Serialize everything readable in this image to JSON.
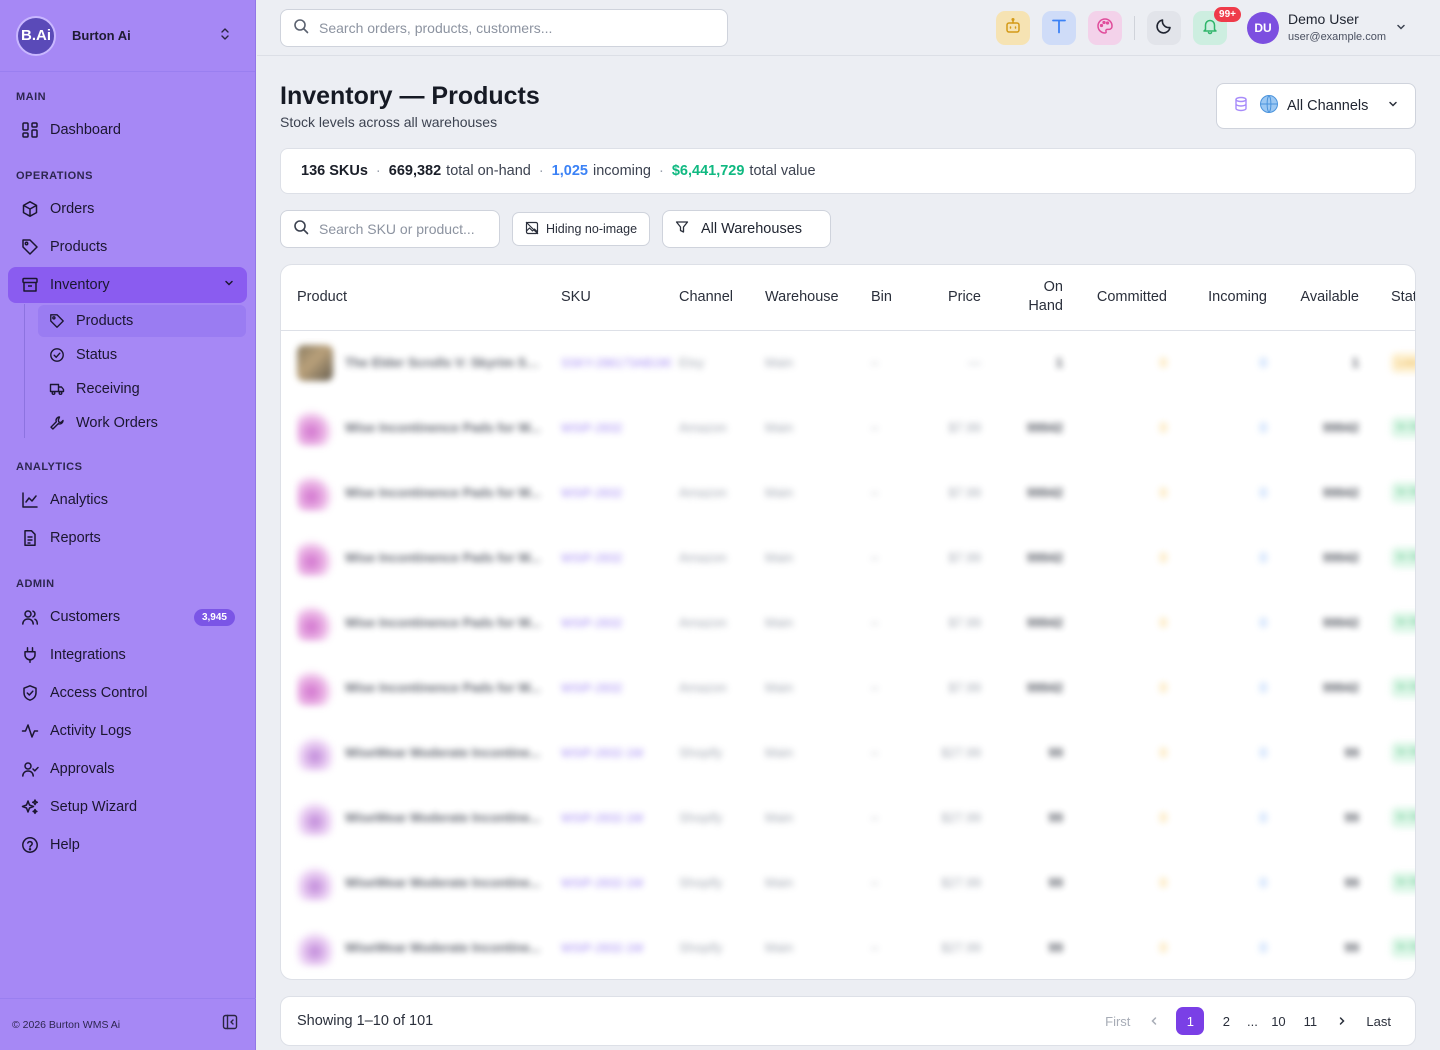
{
  "brand": {
    "logo": "B.Ai",
    "name": "Burton Ai"
  },
  "sidebar": {
    "sections": {
      "main": "MAIN",
      "operations": "OPERATIONS",
      "analytics": "ANALYTICS",
      "admin": "ADMIN"
    },
    "items": {
      "dashboard": "Dashboard",
      "orders": "Orders",
      "products": "Products",
      "inventory": "Inventory",
      "analytics": "Analytics",
      "reports": "Reports",
      "customers": "Customers",
      "customers_count": "3,945",
      "integrations": "Integrations",
      "access_control": "Access Control",
      "activity_logs": "Activity Logs",
      "approvals": "Approvals",
      "setup_wizard": "Setup Wizard",
      "help": "Help"
    },
    "inventory_sub": {
      "products": "Products",
      "status": "Status",
      "receiving": "Receiving",
      "work_orders": "Work Orders"
    },
    "footer": "© 2026 Burton WMS Ai"
  },
  "topbar": {
    "search_placeholder": "Search orders, products, customers...",
    "notification_badge": "99+",
    "user": {
      "initials": "DU",
      "name": "Demo User",
      "email": "user@example.com"
    }
  },
  "page": {
    "title": "Inventory — Products",
    "subtitle": "Stock levels across all warehouses",
    "channel": "All Channels"
  },
  "stats": {
    "skus": "136 SKUs",
    "on_hand_value": "669,382",
    "on_hand_label": "total on-hand",
    "incoming_value": "1,025",
    "incoming_label": "incoming",
    "total_value": "$6,441,729",
    "total_value_label": "total value"
  },
  "filters": {
    "sku_placeholder": "Search SKU or product...",
    "no_image": "Hiding no-image",
    "warehouse": "All Warehouses"
  },
  "table": {
    "columns": {
      "product": "Product",
      "sku": "SKU",
      "channel": "Channel",
      "warehouse": "Warehouse",
      "bin": "Bin",
      "price": "Price",
      "on_hand_1": "On",
      "on_hand_2": "Hand",
      "committed": "Committed",
      "incoming": "Incoming",
      "available": "Available",
      "status": "Status"
    },
    "rows": [
      {
        "product": "The Elder Scrolls V: Skyrim Sp...",
        "sku": "SSKY-286173AB190",
        "channel": "Etsy",
        "warehouse": "Main",
        "bin": "–",
        "price": "—",
        "on_hand": "1",
        "committed": "0",
        "incoming": "0",
        "available": "1",
        "status": "Low Stock"
      },
      {
        "product": "Wise Incontinence Pads for W...",
        "sku": "WSIP-2832",
        "channel": "Amazon",
        "warehouse": "Main",
        "bin": "–",
        "price": "$7.99",
        "on_hand": "99942",
        "committed": "0",
        "incoming": "0",
        "available": "99942",
        "status": "In Stock"
      },
      {
        "product": "Wise Incontinence Pads for W...",
        "sku": "WSIP-2832",
        "channel": "Amazon",
        "warehouse": "Main",
        "bin": "–",
        "price": "$7.99",
        "on_hand": "99942",
        "committed": "0",
        "incoming": "0",
        "available": "99942",
        "status": "In Stock"
      },
      {
        "product": "Wise Incontinence Pads for W...",
        "sku": "WSIP-2832",
        "channel": "Amazon",
        "warehouse": "Main",
        "bin": "–",
        "price": "$7.99",
        "on_hand": "99942",
        "committed": "0",
        "incoming": "0",
        "available": "99942",
        "status": "In Stock"
      },
      {
        "product": "Wise Incontinence Pads for W...",
        "sku": "WSIP-2832",
        "channel": "Amazon",
        "warehouse": "Main",
        "bin": "–",
        "price": "$7.99",
        "on_hand": "99942",
        "committed": "0",
        "incoming": "0",
        "available": "99942",
        "status": "In Stock"
      },
      {
        "product": "Wise Incontinence Pads for W...",
        "sku": "WSIP-2832",
        "channel": "Amazon",
        "warehouse": "Main",
        "bin": "–",
        "price": "$7.99",
        "on_hand": "99942",
        "committed": "0",
        "incoming": "0",
        "available": "99942",
        "status": "In Stock"
      },
      {
        "product": "WiseWear Moderate Incontine...",
        "sku": "WSIP-2832-1M",
        "channel": "Shopify",
        "warehouse": "Main",
        "bin": "–",
        "price": "$27.99",
        "on_hand": "99",
        "committed": "0",
        "incoming": "0",
        "available": "99",
        "status": "In Stock"
      },
      {
        "product": "WiseWear Moderate Incontine...",
        "sku": "WSIP-2832-1M",
        "channel": "Shopify",
        "warehouse": "Main",
        "bin": "–",
        "price": "$27.99",
        "on_hand": "99",
        "committed": "0",
        "incoming": "0",
        "available": "99",
        "status": "In Stock"
      },
      {
        "product": "WiseWear Moderate Incontine...",
        "sku": "WSIP-2832-1M",
        "channel": "Shopify",
        "warehouse": "Main",
        "bin": "–",
        "price": "$27.99",
        "on_hand": "99",
        "committed": "0",
        "incoming": "0",
        "available": "99",
        "status": "In Stock"
      },
      {
        "product": "WiseWear Moderate Incontine...",
        "sku": "WSIP-2832-1M",
        "channel": "Shopify",
        "warehouse": "Main",
        "bin": "–",
        "price": "$27.99",
        "on_hand": "99",
        "committed": "0",
        "incoming": "0",
        "available": "99",
        "status": "In Stock"
      }
    ]
  },
  "pagination": {
    "showing": "Showing 1–10 of 101",
    "first": "First",
    "pages": [
      "1",
      "2",
      "...",
      "10",
      "11"
    ],
    "last": "Last"
  }
}
